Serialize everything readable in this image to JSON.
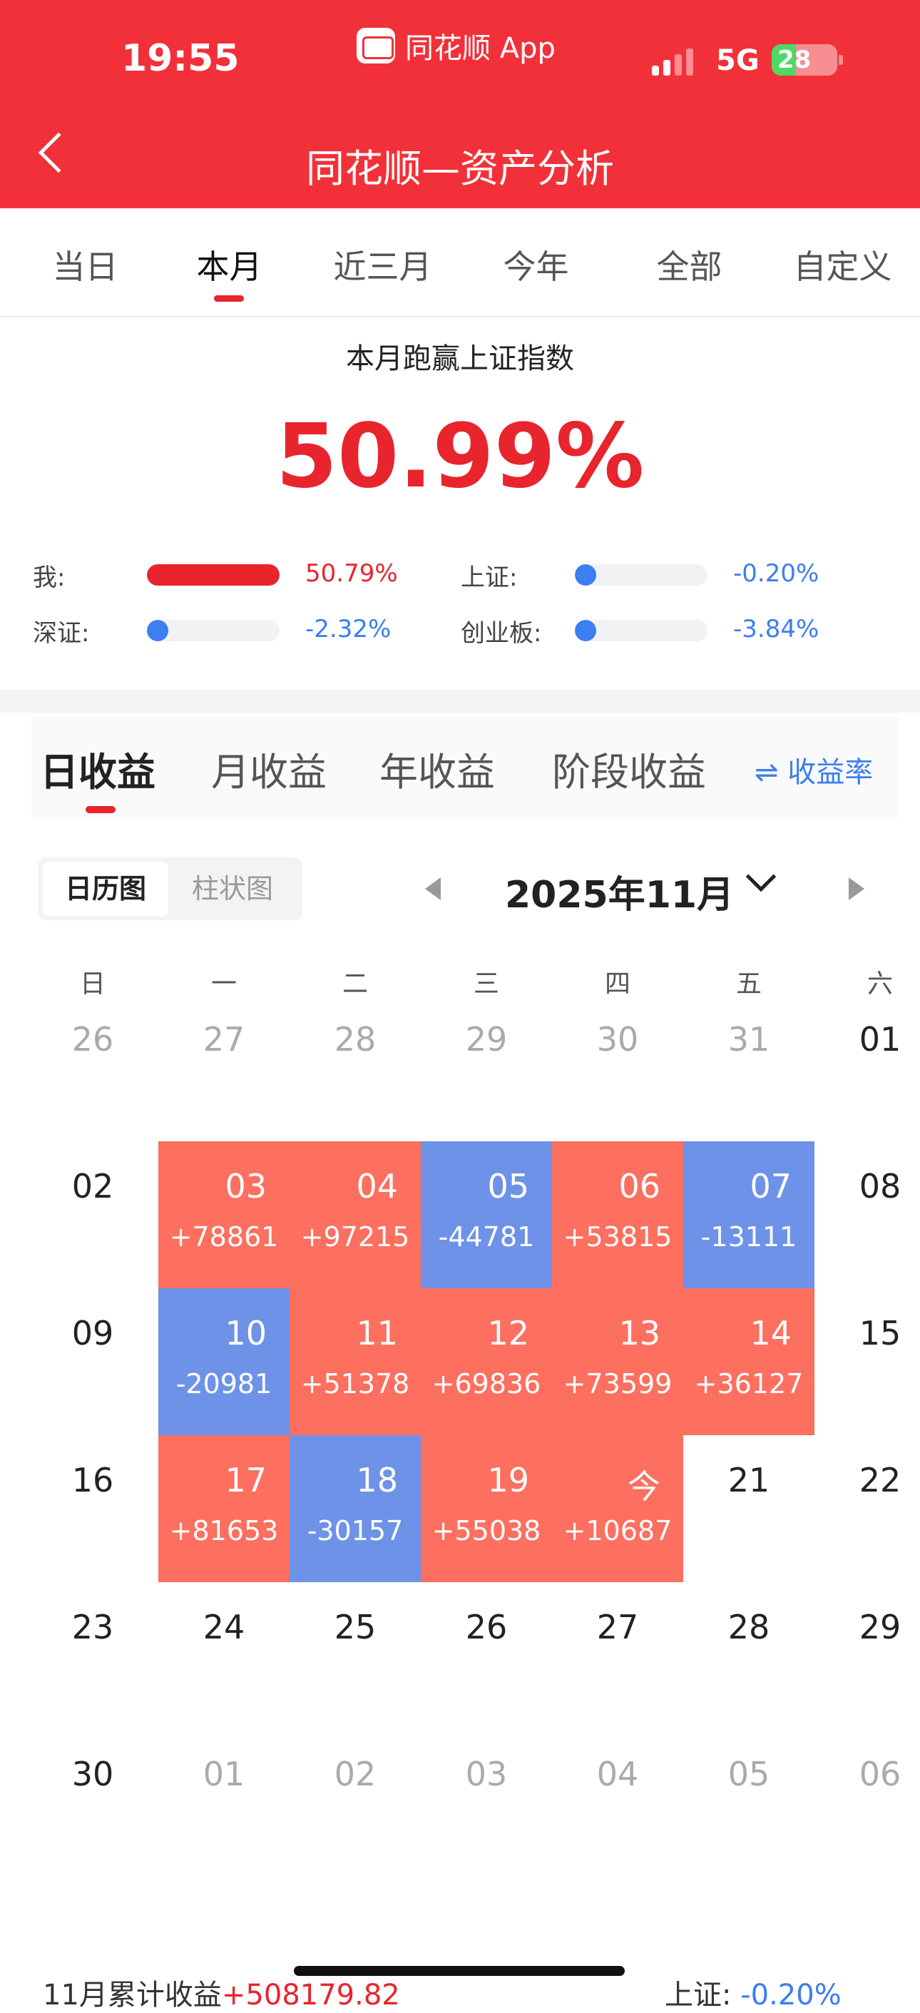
{
  "status_bar": {
    "time": "19:55",
    "source_app": "同花顺 App",
    "network": "5G",
    "battery": "28"
  },
  "nav": {
    "title": "同花顺—资产分析"
  },
  "period_tabs": [
    "当日",
    "本月",
    "近三月",
    "今年",
    "全部",
    "自定义"
  ],
  "active_period": "本月",
  "summary": {
    "headline": "本月跑赢上证指数",
    "big_value": "50.99%",
    "comparisons": [
      {
        "label": "我:",
        "value": "50.79%",
        "level": 1.0,
        "color": "#e8242d"
      },
      {
        "label": "上证:",
        "value": "-0.20%",
        "level": 0.0,
        "color": "#3d7ef0"
      },
      {
        "label": "深证:",
        "value": "-2.32%",
        "level": 0.05,
        "color": "#3d7ef0"
      },
      {
        "label": "创业板:",
        "value": "-3.84%",
        "level": 0.08,
        "color": "#3d7ef0"
      }
    ]
  },
  "income_tabs": [
    "日收益",
    "月收益",
    "年收益",
    "阶段收益"
  ],
  "rate_toggle": "⇌ 收益率",
  "view_toggle": {
    "calendar": "日历图",
    "bar": "柱状图"
  },
  "month_label": "2025年11月",
  "weekdays": [
    "日",
    "一",
    "二",
    "三",
    "四",
    "五",
    "六"
  ],
  "colors": {
    "gain": "#fd6f5f",
    "loss": "#6d92e8",
    "brand_red": "#f23039"
  },
  "calendar": [
    [
      {
        "d": "26",
        "t": "other"
      },
      {
        "d": "27",
        "t": "other"
      },
      {
        "d": "28",
        "t": "other"
      },
      {
        "d": "29",
        "t": "other"
      },
      {
        "d": "30",
        "t": "other"
      },
      {
        "d": "31",
        "t": "other"
      },
      {
        "d": "01",
        "t": "plain"
      }
    ],
    [
      {
        "d": "02",
        "t": "plain"
      },
      {
        "d": "03",
        "t": "pos",
        "p": "+78861"
      },
      {
        "d": "04",
        "t": "pos",
        "p": "+97215"
      },
      {
        "d": "05",
        "t": "neg",
        "p": "-44781"
      },
      {
        "d": "06",
        "t": "pos",
        "p": "+53815"
      },
      {
        "d": "07",
        "t": "neg",
        "p": "-13111"
      },
      {
        "d": "08",
        "t": "plain"
      }
    ],
    [
      {
        "d": "09",
        "t": "plain"
      },
      {
        "d": "10",
        "t": "neg",
        "p": "-20981"
      },
      {
        "d": "11",
        "t": "pos",
        "p": "+51378"
      },
      {
        "d": "12",
        "t": "pos",
        "p": "+69836"
      },
      {
        "d": "13",
        "t": "pos",
        "p": "+73599"
      },
      {
        "d": "14",
        "t": "pos",
        "p": "+36127"
      },
      {
        "d": "15",
        "t": "plain"
      }
    ],
    [
      {
        "d": "16",
        "t": "plain"
      },
      {
        "d": "17",
        "t": "pos",
        "p": "+81653"
      },
      {
        "d": "18",
        "t": "neg",
        "p": "-30157"
      },
      {
        "d": "19",
        "t": "pos",
        "p": "+55038"
      },
      {
        "d": "今",
        "t": "pos",
        "p": "+10687"
      },
      {
        "d": "21",
        "t": "plain"
      },
      {
        "d": "22",
        "t": "plain"
      }
    ],
    [
      {
        "d": "23",
        "t": "plain"
      },
      {
        "d": "24",
        "t": "plain"
      },
      {
        "d": "25",
        "t": "plain"
      },
      {
        "d": "26",
        "t": "plain"
      },
      {
        "d": "27",
        "t": "plain"
      },
      {
        "d": "28",
        "t": "plain"
      },
      {
        "d": "29",
        "t": "plain"
      }
    ],
    [
      {
        "d": "30",
        "t": "plain"
      },
      {
        "d": "01",
        "t": "other"
      },
      {
        "d": "02",
        "t": "other"
      },
      {
        "d": "03",
        "t": "other"
      },
      {
        "d": "04",
        "t": "other"
      },
      {
        "d": "05",
        "t": "other"
      },
      {
        "d": "06",
        "t": "other"
      }
    ]
  ],
  "footer": {
    "cum_label": "11月累计收益",
    "cum_value": "+508179.82",
    "index_label": "上证:",
    "index_value": "-0.20%"
  }
}
